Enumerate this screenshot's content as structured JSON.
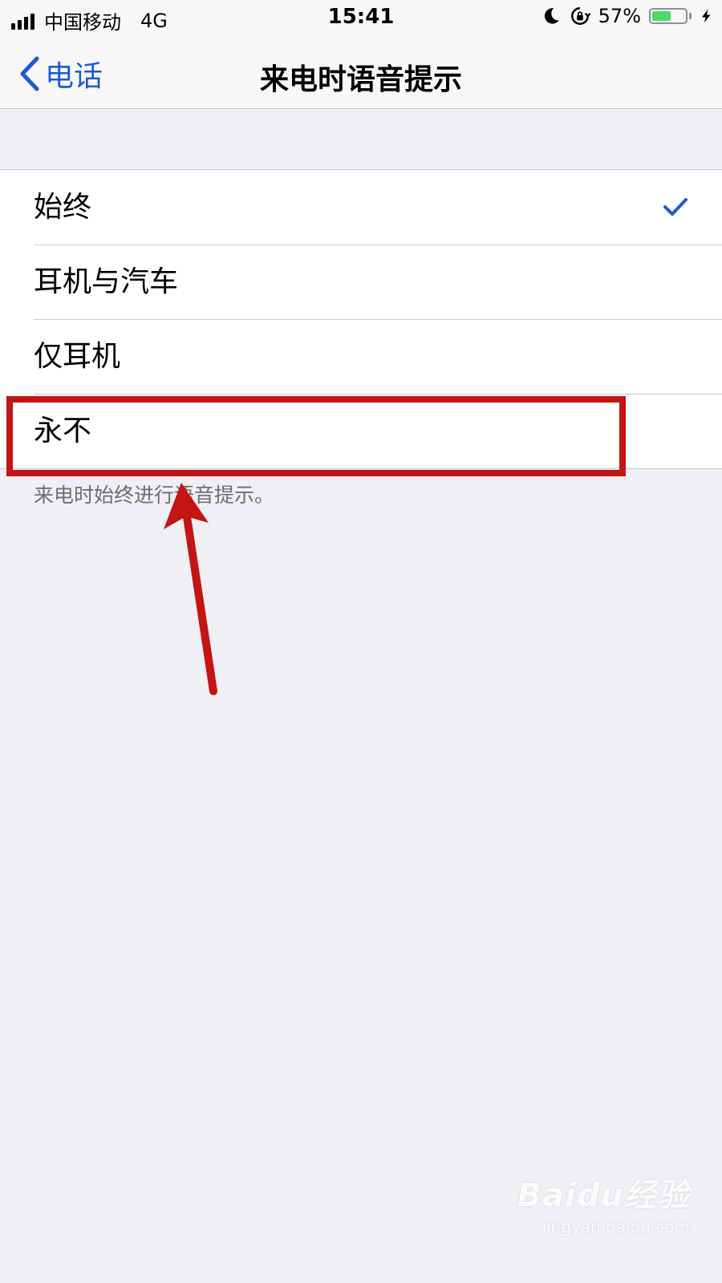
{
  "status_bar": {
    "carrier": "中国移动",
    "network": "4G",
    "time": "15:41",
    "battery_percent": "57%",
    "battery_level": 0.57,
    "icons": [
      "signal-icon",
      "moon-icon",
      "lock-rotation-icon",
      "battery-icon",
      "bolt-icon"
    ]
  },
  "nav": {
    "back_label": "电话",
    "title": "来电时语音提示"
  },
  "options": [
    {
      "label": "始终",
      "selected": true
    },
    {
      "label": "耳机与汽车",
      "selected": false
    },
    {
      "label": "仅耳机",
      "selected": false
    },
    {
      "label": "永不",
      "selected": false
    }
  ],
  "footer_note": "来电时始终进行语音提示。",
  "colors": {
    "accent": "#1d5ad8",
    "annotation": "#c41414",
    "background": "#efeff4"
  },
  "watermark": {
    "brand": "Baidu经验",
    "url": "jingyan.baidu.com"
  }
}
